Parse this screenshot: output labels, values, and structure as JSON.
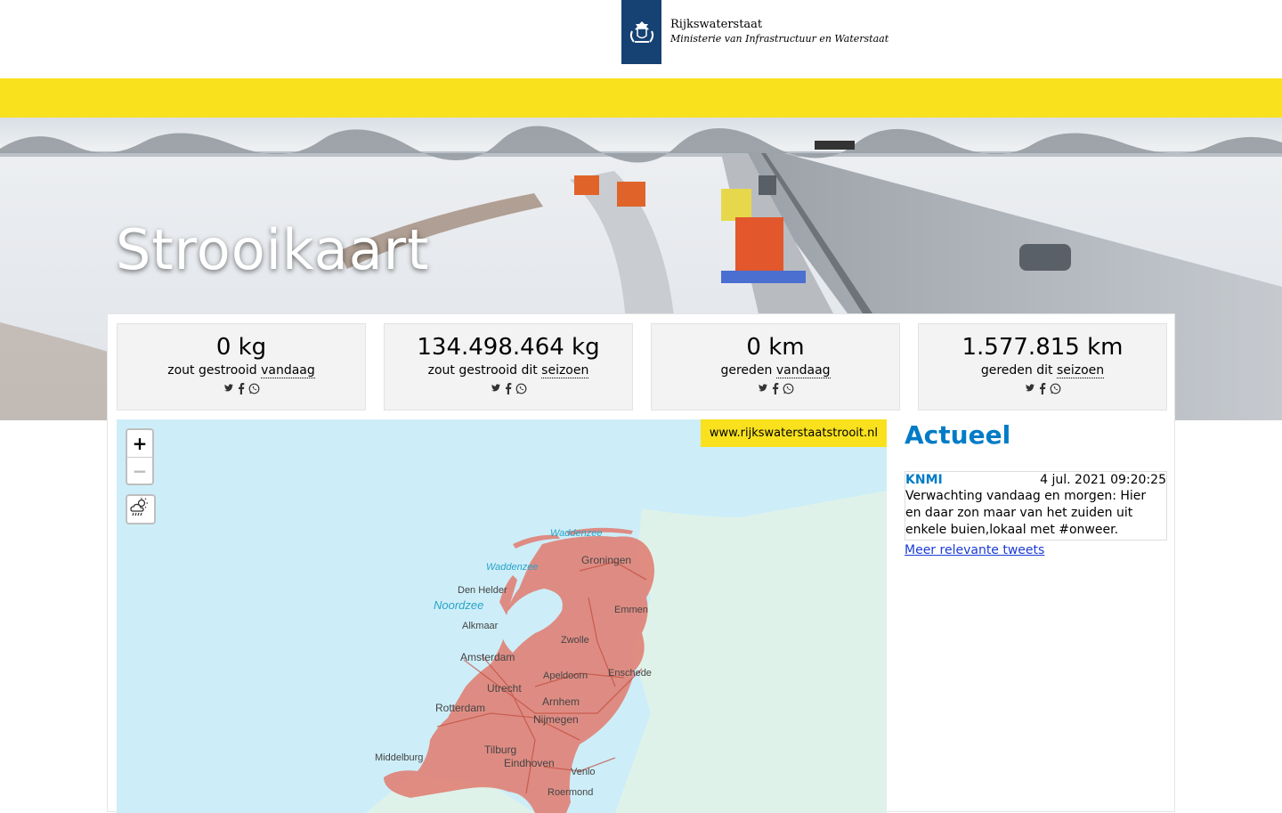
{
  "header": {
    "org_name": "Rijkswaterstaat",
    "ministry": "Ministerie van Infrastructuur en Waterstaat",
    "logo_icon": "coat-of-arms-icon",
    "brand_color": "#154273",
    "accent_color": "#f9e11e"
  },
  "hero": {
    "title": "Strooikaart"
  },
  "stats": [
    {
      "value": "0 kg",
      "label_prefix": "zout gestrooid ",
      "label_link": "vandaag"
    },
    {
      "value": "134.498.464 kg",
      "label_prefix": "zout gestrooid dit ",
      "label_link": "seizoen"
    },
    {
      "value": "0 km",
      "label_prefix": "gereden ",
      "label_link": "vandaag"
    },
    {
      "value": "1.577.815 km",
      "label_prefix": "gereden dit ",
      "label_link": "seizoen"
    }
  ],
  "share_icons": [
    "twitter-icon",
    "facebook-icon",
    "whatsapp-icon"
  ],
  "map": {
    "zoom_in": "+",
    "zoom_out": "−",
    "weather_icon": "weather-rain-icon",
    "url_badge": "www.rijkswaterstaatstrooit.nl",
    "labels": {
      "waddenzee_1": "Waddenzee",
      "waddenzee_2": "Waddenzee",
      "groningen": "Groningen",
      "den_helder": "Den Helder",
      "noordzee": "Noordzee",
      "emmen": "Emmen",
      "alkmaar": "Alkmaar",
      "zwolle": "Zwolle",
      "amsterdam": "Amsterdam",
      "enschede": "Enschede",
      "apeldoorn": "Apeldoorn",
      "utrecht": "Utrecht",
      "arnhem": "Arnhem",
      "rotterdam": "Rotterdam",
      "nijmegen": "Nijmegen",
      "tilburg": "Tilburg",
      "middelburg": "Middelburg",
      "eindhoven": "Eindhoven",
      "venlo": "Venlo",
      "roermond": "Roermond"
    }
  },
  "actueel": {
    "title": "Actueel",
    "tweet": {
      "author": "KNMI",
      "time": "4 jul. 2021 09:20:25",
      "text": "Verwachting vandaag en morgen: Hier en daar zon maar van het zuiden uit enkele buien,lokaal met #onweer. Maandag af..."
    },
    "more_link": "Meer relevante tweets"
  }
}
